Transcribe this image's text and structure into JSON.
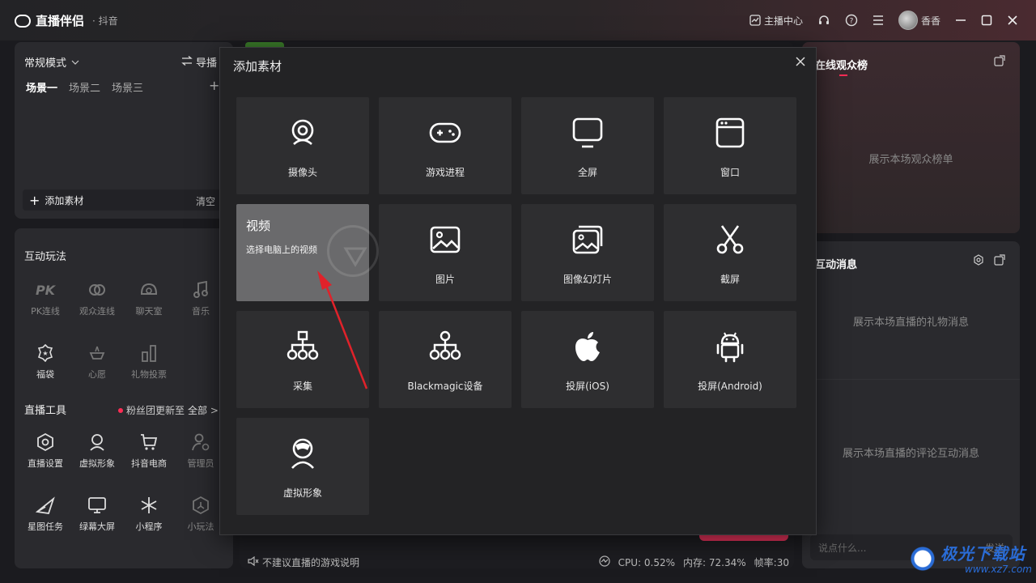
{
  "titlebar": {
    "app_name": "直播伴侣",
    "platform": "· 抖音",
    "creator_center": "主播中心",
    "username": "香香"
  },
  "scene_panel": {
    "mode": "常规模式",
    "guide": "导播",
    "scenes": [
      "场景一",
      "场景二",
      "场景三"
    ],
    "add_material": "添加素材",
    "clear": "清空"
  },
  "tools_panel": {
    "interactive_title": "互动玩法",
    "interactive_items": [
      {
        "label": "PK连线",
        "icon": "pk-icon"
      },
      {
        "label": "观众连线",
        "icon": "link-icon"
      },
      {
        "label": "聊天室",
        "icon": "chatroom-icon"
      },
      {
        "label": "音乐",
        "icon": "music-icon"
      },
      {
        "label": "福袋",
        "icon": "lucky-bag-icon"
      },
      {
        "label": "心愿",
        "icon": "wish-icon"
      },
      {
        "label": "礼物投票",
        "icon": "vote-icon"
      }
    ],
    "live_tools_title": "直播工具",
    "fans_notice": "粉丝团更新至",
    "all": "全部 >",
    "tool_items": [
      {
        "label": "直播设置",
        "icon": "settings-hex-icon"
      },
      {
        "label": "虚拟形象",
        "icon": "avatar-icon"
      },
      {
        "label": "抖音电商",
        "icon": "cart-icon"
      },
      {
        "label": "管理员",
        "icon": "admin-icon"
      },
      {
        "label": "星图任务",
        "icon": "star-task-icon"
      },
      {
        "label": "绿幕大屏",
        "icon": "green-screen-icon"
      },
      {
        "label": "小程序",
        "icon": "mini-program-icon"
      },
      {
        "label": "小玩法",
        "icon": "mini-game-icon"
      }
    ]
  },
  "status_bar": {
    "notice": "不建议直播的游戏说明",
    "cpu": "CPU: 0.52%",
    "memory": "内存: 72.34%",
    "fps": "帧率:30"
  },
  "right_panel": {
    "audience_title": "在线观众榜",
    "audience_placeholder": "展示本场观众榜单",
    "messages_title": "互动消息",
    "gift_placeholder": "展示本场直播的礼物消息",
    "comment_placeholder": "展示本场直播的评论互动消息",
    "input_placeholder": "说点什么...",
    "send": "发送"
  },
  "modal": {
    "title": "添加素材",
    "tiles": [
      {
        "label": "摄像头",
        "icon": "camera-icon"
      },
      {
        "label": "游戏进程",
        "icon": "gamepad-icon"
      },
      {
        "label": "全屏",
        "icon": "monitor-icon"
      },
      {
        "label": "窗口",
        "icon": "window-icon"
      },
      {
        "label": "视频",
        "icon": "video-icon",
        "hover_title": "视频",
        "hover_desc": "选择电脑上的视频"
      },
      {
        "label": "图片",
        "icon": "image-icon"
      },
      {
        "label": "图像幻灯片",
        "icon": "slideshow-icon"
      },
      {
        "label": "截屏",
        "icon": "scissors-icon"
      },
      {
        "label": "采集",
        "icon": "capture-tree-icon"
      },
      {
        "label": "Blackmagic设备",
        "icon": "blackmagic-icon"
      },
      {
        "label": "投屏(iOS)",
        "icon": "apple-icon"
      },
      {
        "label": "投屏(Android)",
        "icon": "android-icon"
      },
      {
        "label": "虚拟形象",
        "icon": "virtual-avatar-icon"
      }
    ]
  },
  "watermark": {
    "text": "极光下载站",
    "url": "www.xz7.com"
  }
}
